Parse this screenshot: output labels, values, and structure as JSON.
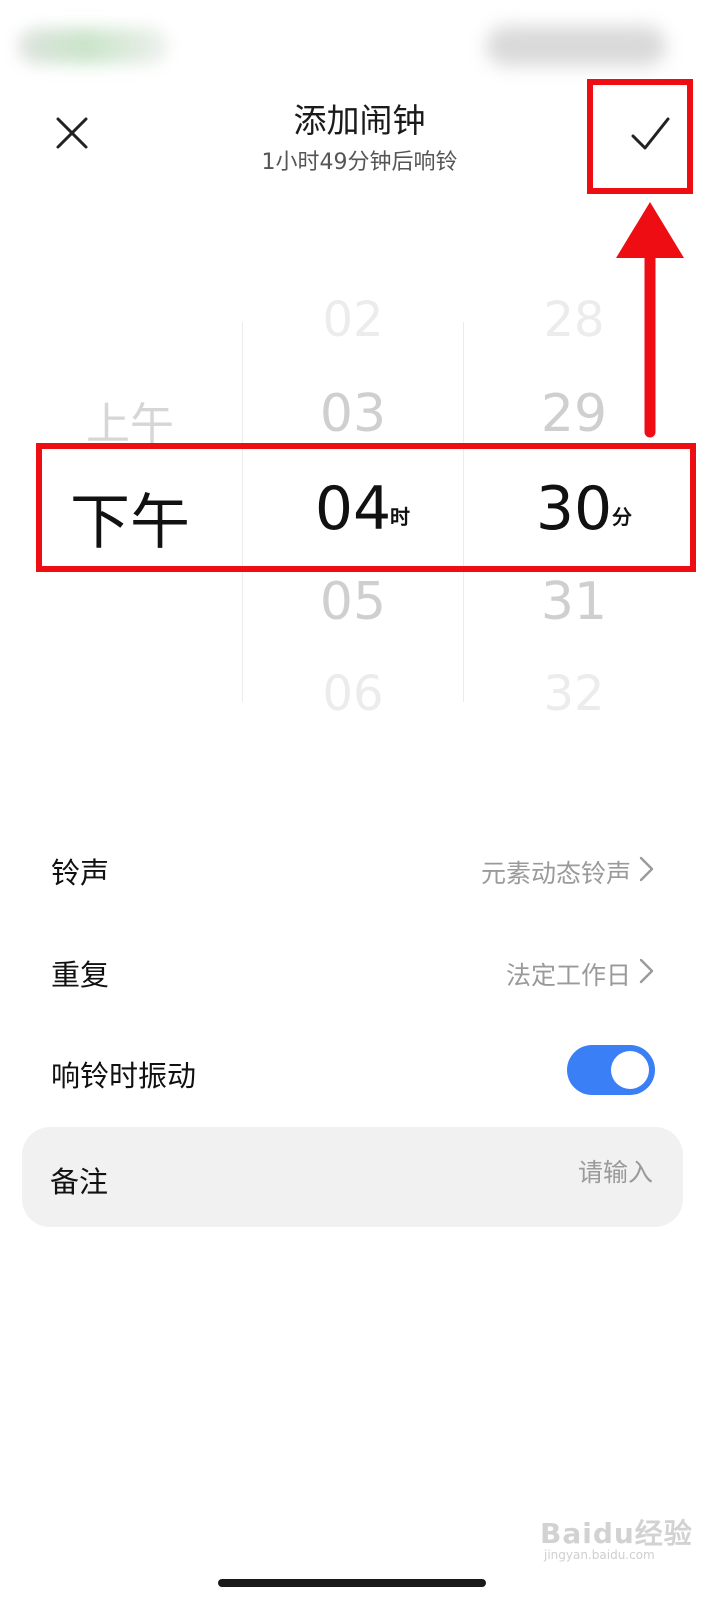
{
  "header": {
    "title": "添加闹钟",
    "subtitle": "1小时49分钟后响铃"
  },
  "picker": {
    "ampm": {
      "above": "上午",
      "selected": "下午"
    },
    "hours": {
      "items": [
        "02",
        "03",
        "04",
        "05",
        "06"
      ],
      "selected": "04",
      "unit": "时"
    },
    "minutes": {
      "items": [
        "28",
        "29",
        "30",
        "31",
        "32"
      ],
      "selected": "30",
      "unit": "分"
    }
  },
  "settings": {
    "ringtone": {
      "label": "铃声",
      "value": "元素动态铃声"
    },
    "repeat": {
      "label": "重复",
      "value": "法定工作日"
    },
    "vibrate": {
      "label": "响铃时振动",
      "on": true
    },
    "note": {
      "label": "备注",
      "placeholder": "请输入"
    }
  },
  "watermark": {
    "main": "Baidu经验",
    "sub": "jingyan.baidu.com"
  },
  "colors": {
    "accent": "#3b7ff6",
    "highlight": "#ef0d14"
  },
  "icons": {
    "close": "close-icon",
    "confirm": "check-icon",
    "chevron": "chevron-right-icon"
  }
}
